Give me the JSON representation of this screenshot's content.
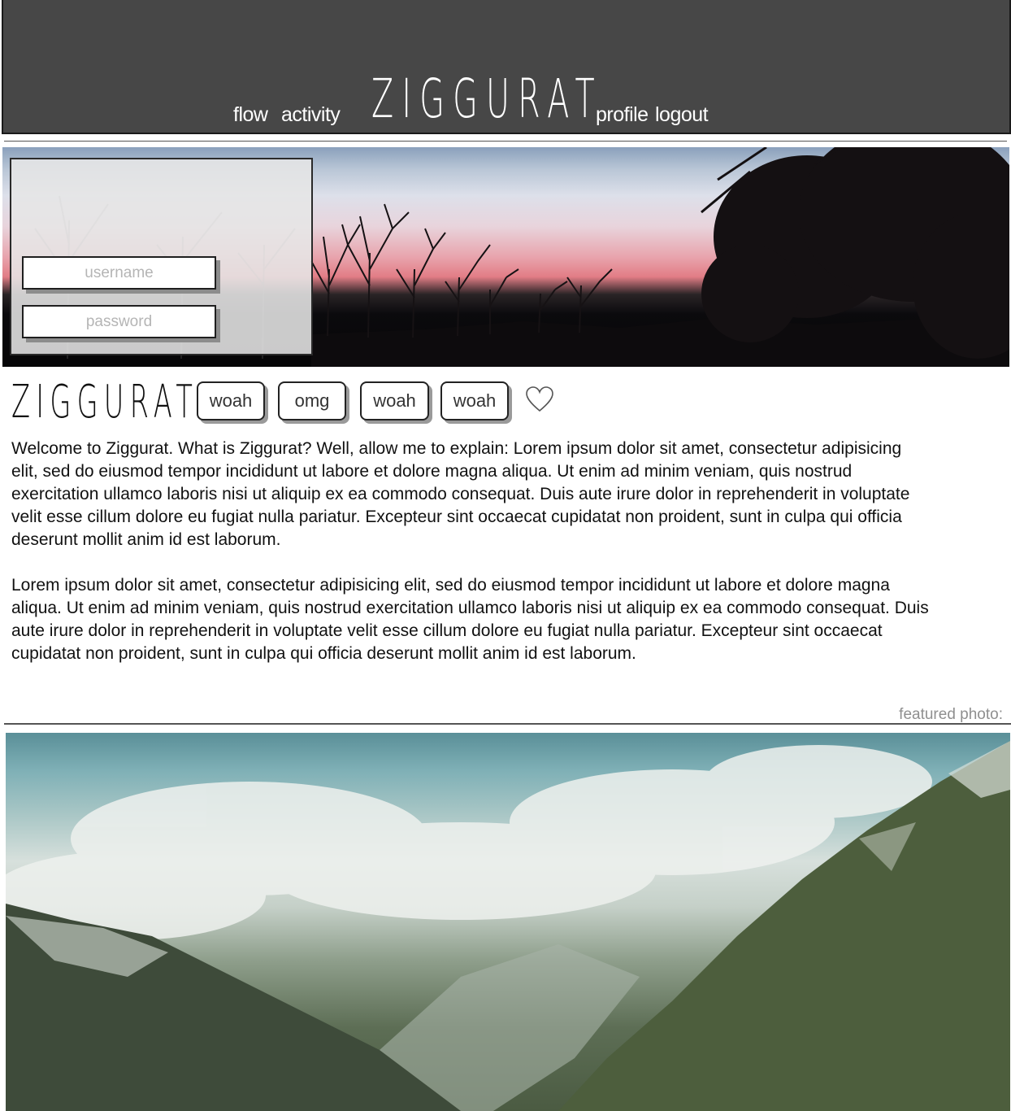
{
  "header": {
    "nav_left": [
      "flow",
      "activity"
    ],
    "brand": "ZIGGURAT",
    "nav_right": [
      "profile",
      "logout"
    ]
  },
  "login": {
    "username_placeholder": "username",
    "password_placeholder": "password"
  },
  "brand_row": {
    "logo": "ZIGGURAT",
    "reactions": [
      "woah",
      "omg",
      "woah",
      "woah"
    ],
    "like_icon": "heart-icon"
  },
  "content": {
    "paragraphs": [
      "Welcome to Ziggurat.  What is Ziggurat? Well, allow me to explain: Lorem ipsum dolor sit amet, consectetur adipisicing elit, sed do eiusmod tempor incididunt ut labore et dolore magna aliqua. Ut enim ad minim veniam, quis nostrud exercitation ullamco laboris nisi ut aliquip ex ea commodo consequat. Duis aute irure dolor in reprehenderit in voluptate velit esse cillum dolore eu fugiat nulla pariatur. Excepteur sint occaecat cupidatat non proident, sunt in culpa qui officia deserunt mollit anim id est laborum.",
      "Lorem ipsum dolor sit amet, consectetur adipisicing elit, sed do eiusmod tempor incididunt ut labore et dolore magna aliqua. Ut enim ad minim veniam, quis nostrud exercitation ullamco laboris nisi ut aliquip ex ea commodo consequat. Duis aute irure dolor in reprehenderit in voluptate velit esse cillum dolore eu fugiat nulla pariatur. Excepteur sint occaecat cupidatat non proident, sunt in culpa qui officia deserunt mollit anim id est laborum."
    ]
  },
  "featured": {
    "label": "featured photo:"
  },
  "colors": {
    "header_bg": "#474747",
    "nav_text": "#ffffff",
    "placeholder_text": "#b5b5b5",
    "featured_label": "#8f8f8f"
  }
}
